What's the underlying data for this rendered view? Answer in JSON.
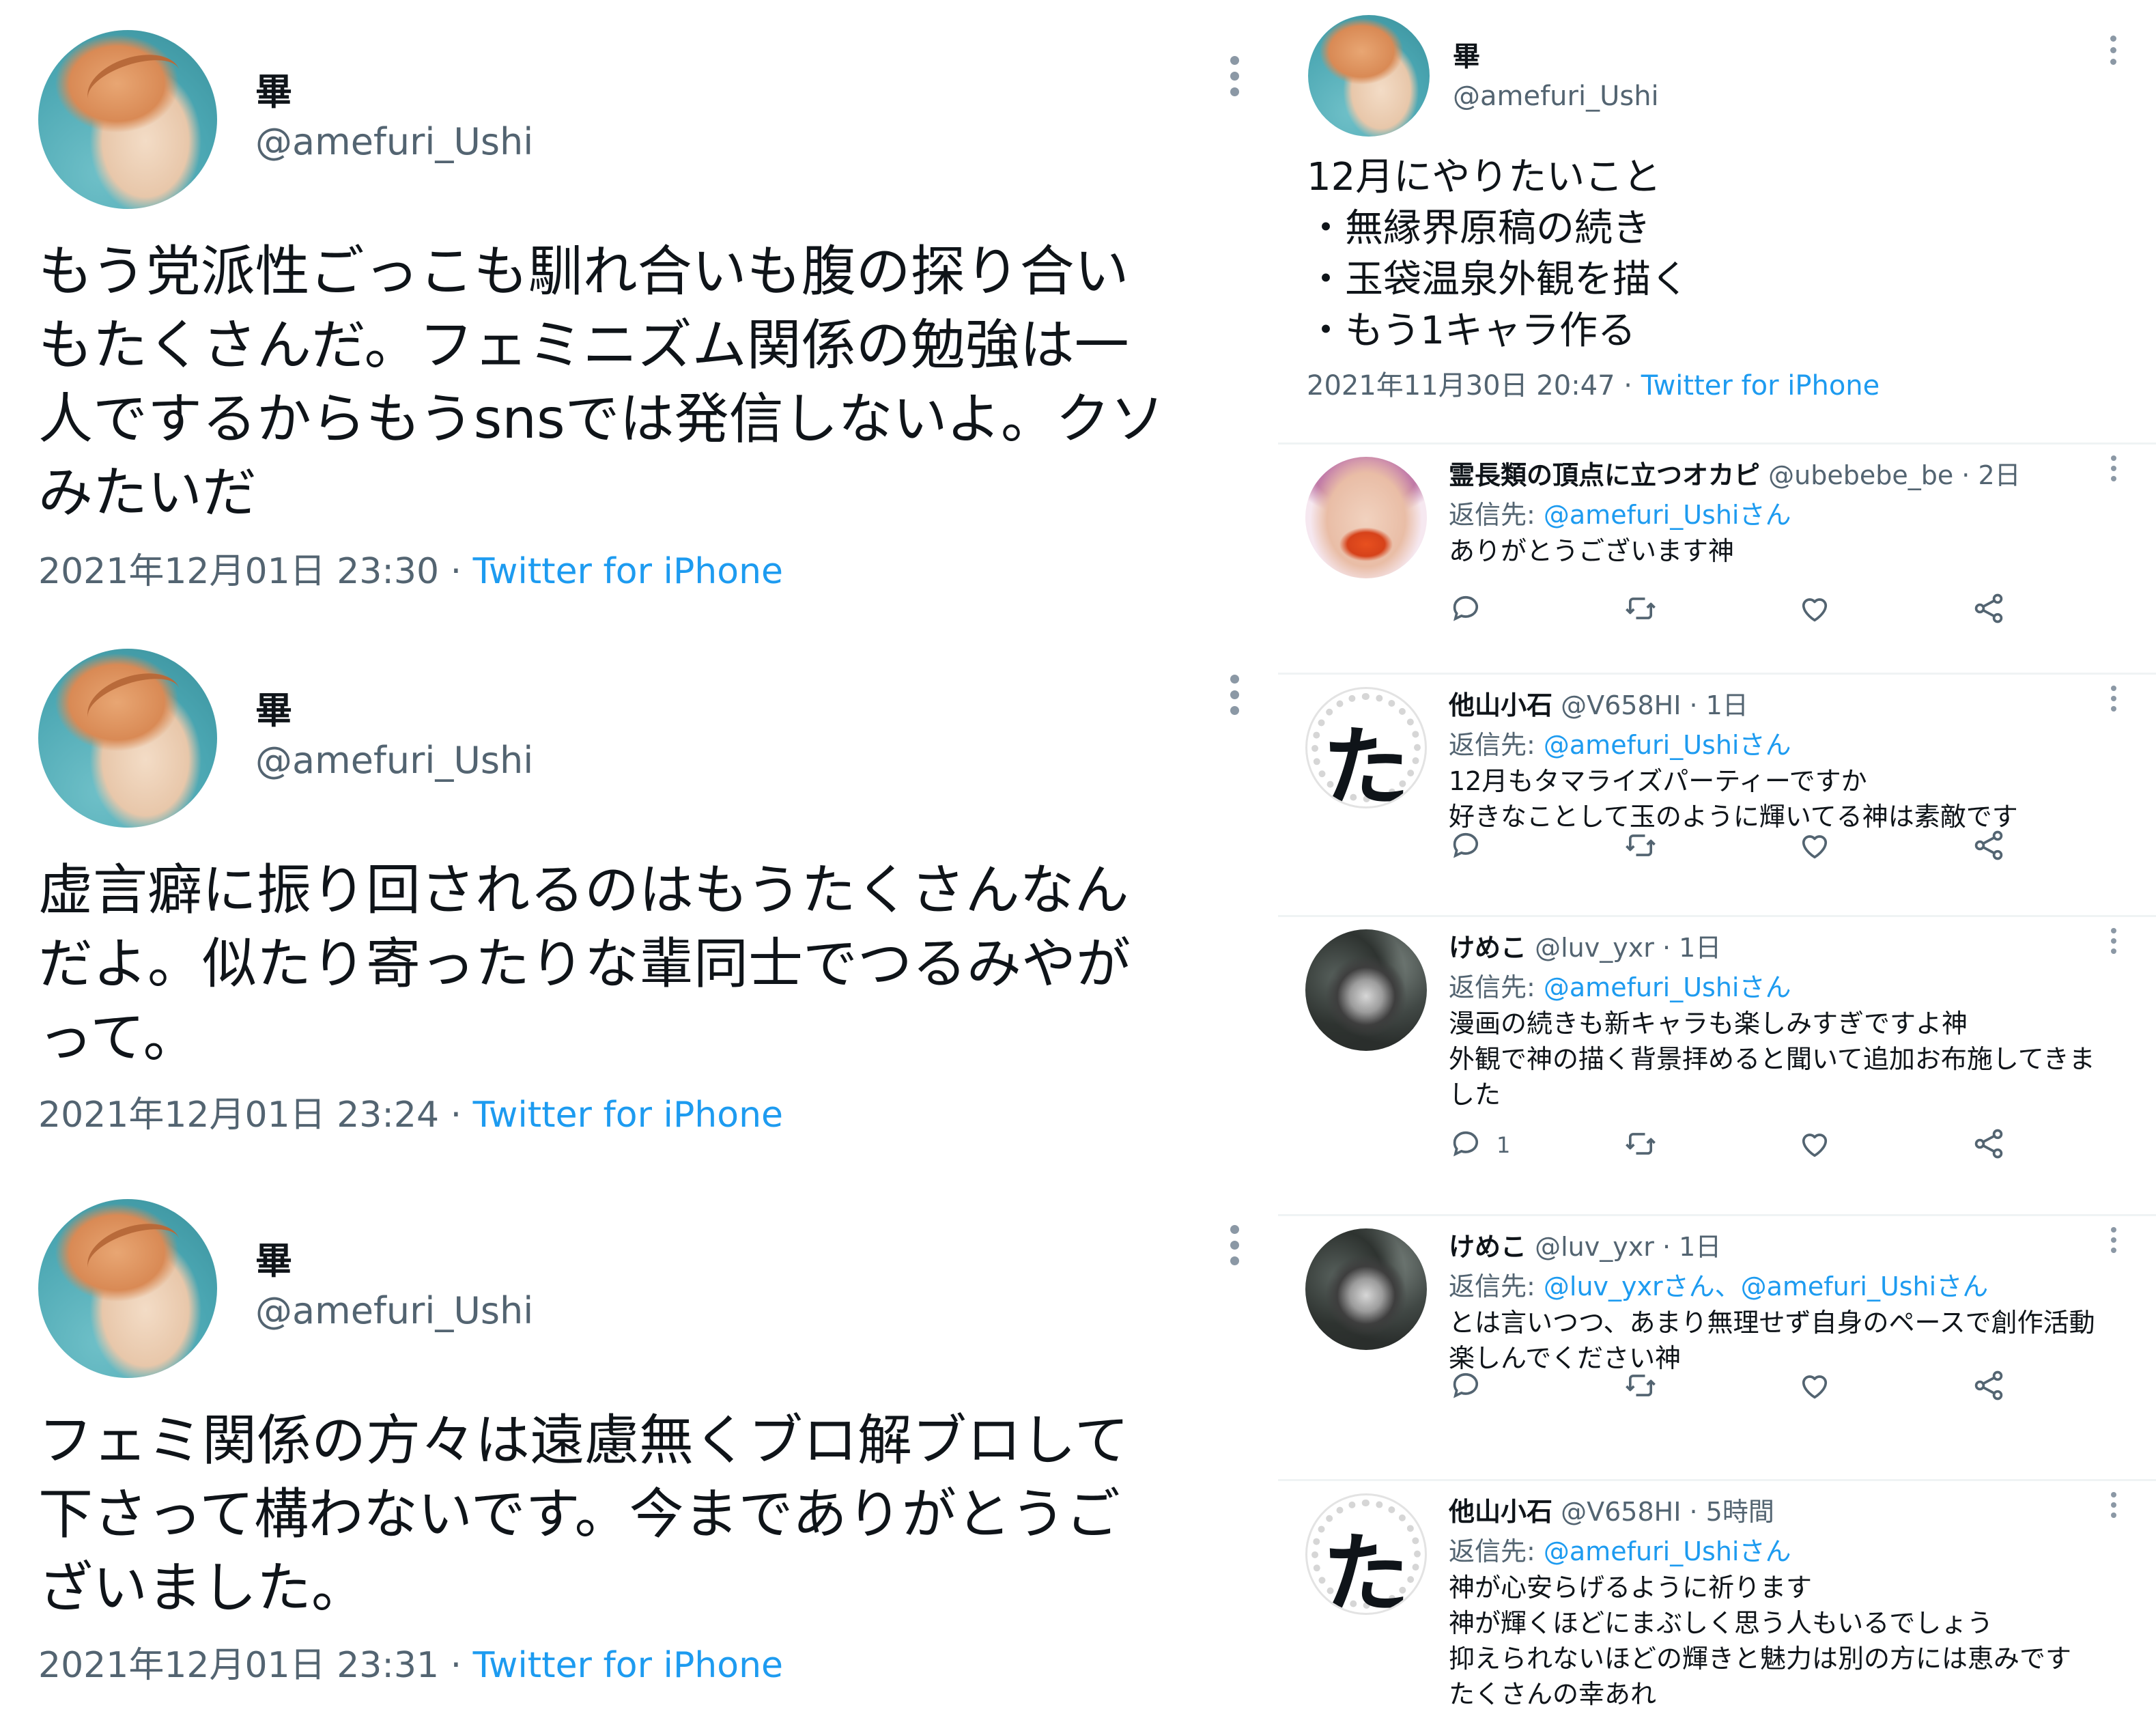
{
  "left_tweets": [
    {
      "name": "畢",
      "handle": "@amefuri_Ushi",
      "text": "もう党派性ごっこも馴れ合いも腹の探り合い\nもたくさんだ。フェミニズム関係の勉強は一\n人でするからもうsnsでは発信しないよ。クソ\nみたいだ",
      "timestamp": "2021年12月01日 23:30",
      "separator": " · ",
      "client": "Twitter for iPhone"
    },
    {
      "name": "畢",
      "handle": "@amefuri_Ushi",
      "text": "虚言癖に振り回されるのはもうたくさんなん\nだよ。似たり寄ったりな輩同士でつるみやが\nって。",
      "timestamp": "2021年12月01日 23:24",
      "separator": " · ",
      "client": "Twitter for iPhone"
    },
    {
      "name": "畢",
      "handle": "@amefuri_Ushi",
      "text": "フェミ関係の方々は遠慮無くブロ解ブロして\n下さって構わないです。今までありがとうご\nざいました。",
      "timestamp": "2021年12月01日 23:31",
      "separator": " · ",
      "client": "Twitter for iPhone"
    }
  ],
  "main_tweet": {
    "name": "畢",
    "handle": "@amefuri_Ushi",
    "text": "12月にやりたいこと\n・無縁界原稿の続き\n・玉袋温泉外観を描く\n・もう1キャラ作る",
    "timestamp": "2021年11月30日 20:47",
    "separator": " · ",
    "client": "Twitter for iPhone"
  },
  "replies": [
    {
      "name": "霊長類の頂点に立つオカピ",
      "handle": "@ubebebe_be",
      "time": "· 2日",
      "reply_to_label": "返信先: ",
      "reply_to": "@amefuri_Ushiさん",
      "text": "ありがとうございます神",
      "avatar_icon": "avatar-pink-icon",
      "reply_count": ""
    },
    {
      "name": "他山小石",
      "handle": "@V658HI",
      "time": "· 1日",
      "reply_to_label": "返信先: ",
      "reply_to": "@amefuri_Ushiさん",
      "text": "12月もタマライズパーティーですか\n好きなことして玉のように輝いてる神は素敵です",
      "avatar_icon": "avatar-ta-icon",
      "avatar_glyph": "た",
      "reply_count": ""
    },
    {
      "name": "けめこ",
      "handle": "@luv_yxr",
      "time": "· 1日",
      "reply_to_label": "返信先: ",
      "reply_to": "@amefuri_Ushiさん",
      "text": "漫画の続きも新キャラも楽しみすぎですよ神\n外観で神の描く背景拝めると聞いて追加お布施してきま\nした",
      "avatar_icon": "avatar-dark-icon",
      "reply_count": "1"
    },
    {
      "name": "けめこ",
      "handle": "@luv_yxr",
      "time": "· 1日",
      "reply_to_label": "返信先: ",
      "reply_to": "@luv_yxrさん、@amefuri_Ushiさん",
      "text": "とは言いつつ、あまり無理せず自身のペースで創作活動\n楽しんでください神",
      "avatar_icon": "avatar-dark-icon",
      "reply_count": ""
    },
    {
      "name": "他山小石",
      "handle": "@V658HI",
      "time": "· 5時間",
      "reply_to_label": "返信先: ",
      "reply_to": "@amefuri_Ushiさん",
      "text": "神が心安らげるように祈ります\n神が輝くほどにまぶしく思う人もいるでしょう\n抑えられないほどの輝きと魅力は別の方には恵みです\nたくさんの幸あれ",
      "avatar_icon": "avatar-ta-icon",
      "avatar_glyph": "た",
      "reply_count": ""
    }
  ],
  "colors": {
    "link": "#1d9bf0",
    "secondary_text": "#536471",
    "primary_text": "#0f1419",
    "divider": "#eff3f4"
  },
  "action_icons": [
    "reply-icon",
    "retweet-icon",
    "like-icon",
    "share-icon"
  ]
}
